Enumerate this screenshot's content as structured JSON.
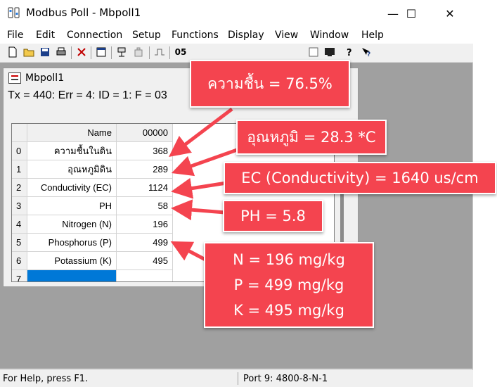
{
  "window": {
    "title": "Modbus Poll - Mbpoll1",
    "controls": {
      "minimize": "—",
      "maximize": "☐",
      "close": "✕"
    }
  },
  "menu": [
    "File",
    "Edit",
    "Connection",
    "Setup",
    "Functions",
    "Display",
    "View",
    "Window",
    "Help"
  ],
  "toolbar": {
    "label_05": "05"
  },
  "child": {
    "title": "Mbpoll1",
    "status": "Tx = 440: Err = 4: ID = 1: F = 03"
  },
  "grid": {
    "header_name": "Name",
    "header_value": "00000",
    "rows": [
      {
        "idx": "0",
        "name": "ความชื้นในดิน",
        "value": "368"
      },
      {
        "idx": "1",
        "name": "อุณหภูมิดิน",
        "value": "289"
      },
      {
        "idx": "2",
        "name": "Conductivity (EC)",
        "value": "1124"
      },
      {
        "idx": "3",
        "name": "PH",
        "value": "58"
      },
      {
        "idx": "4",
        "name": "Nitrogen (N)",
        "value": "196"
      },
      {
        "idx": "5",
        "name": "Phosphorus (P)",
        "value": "499"
      },
      {
        "idx": "6",
        "name": "Potassium (K)",
        "value": "495"
      },
      {
        "idx": "7",
        "name": "",
        "value": ""
      }
    ]
  },
  "statusbar": {
    "help": "For Help, press F1.",
    "port": "Port 9: 4800-8-N-1"
  },
  "callouts": {
    "humidity": "ความชื้น = 76.5%",
    "temperature": "อุณหภูมิ = 28.3 *C",
    "ec": "EC (Conductivity) = 1640 us/cm",
    "ph": "PH = 5.8",
    "npk": [
      "N = 196 mg/kg",
      "P = 499 mg/kg",
      "K = 495 mg/kg"
    ]
  },
  "colors": {
    "callout_bg": "#f4444f",
    "selection": "#0078d7"
  }
}
